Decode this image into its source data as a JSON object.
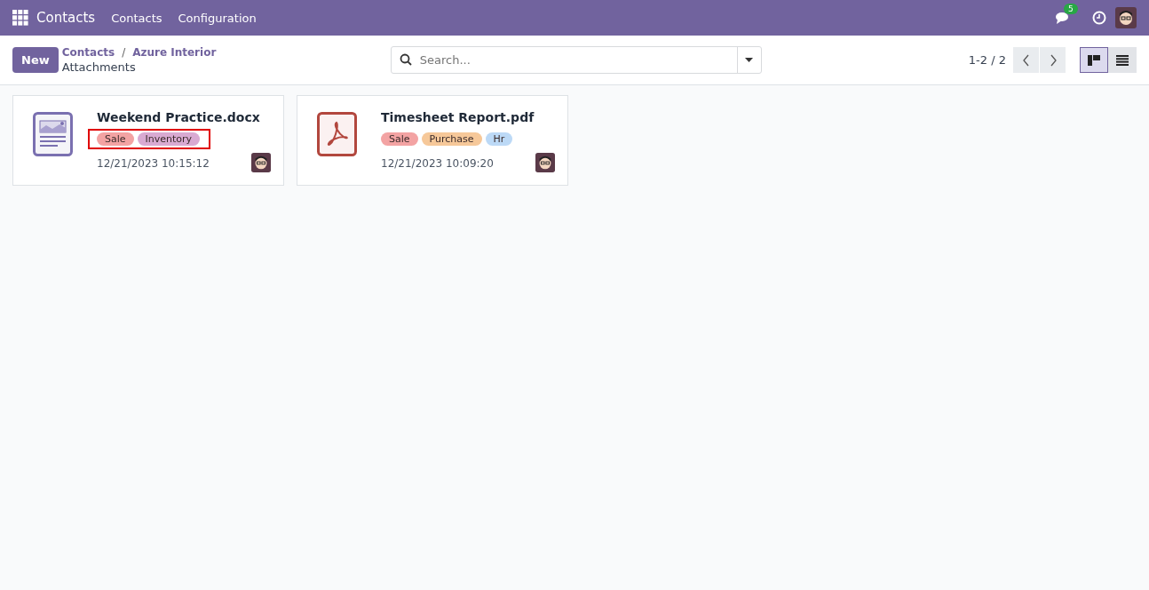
{
  "navbar": {
    "app_name": "Contacts",
    "menus": [
      "Contacts",
      "Configuration"
    ],
    "messages_count": "5"
  },
  "control_panel": {
    "new_button": "New",
    "breadcrumbs": [
      "Contacts",
      "Azure Interior"
    ],
    "breadcrumb_separator": "/",
    "title": "Attachments",
    "search": {
      "placeholder": "Search..."
    },
    "pager": "1-2 / 2",
    "views": [
      {
        "kind": "kanban",
        "selected": true
      },
      {
        "kind": "list",
        "selected": false
      }
    ]
  },
  "cards": [
    {
      "kind": "document",
      "name": "Weekend Practice.docx",
      "tags_highlighted": true,
      "tags": [
        {
          "label": "Sale",
          "color": "#f3a3a3"
        },
        {
          "label": "Inventory",
          "color": "#d9aad2"
        }
      ],
      "date": "12/21/2023 10:15:12"
    },
    {
      "kind": "pdf",
      "name": "Timesheet Report.pdf",
      "tags_highlighted": false,
      "tags": [
        {
          "label": "Sale",
          "color": "#f3a3a3"
        },
        {
          "label": "Purchase",
          "color": "#f6c899"
        },
        {
          "label": "Hr",
          "color": "#bcd9f6"
        }
      ],
      "date": "12/21/2023 10:09:20"
    }
  ]
}
